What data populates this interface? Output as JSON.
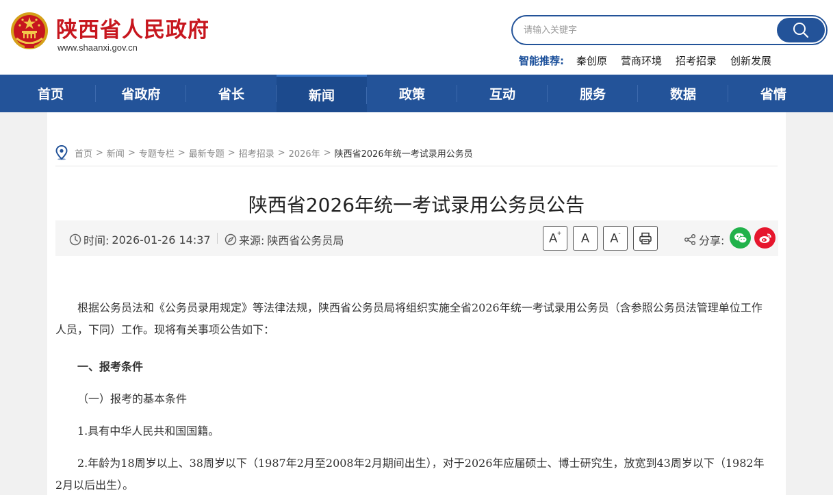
{
  "site": {
    "title": "陕西省人民政府",
    "domain": "www.shaanxi.gov.cn"
  },
  "search": {
    "placeholder": "请输入关键字",
    "icon": "search-icon"
  },
  "recommend": {
    "label": "智能推荐:",
    "items": [
      "秦创原",
      "营商环境",
      "招考招录",
      "创新发展"
    ]
  },
  "nav": {
    "items": [
      "首页",
      "省政府",
      "省长",
      "新闻",
      "政策",
      "互动",
      "服务",
      "数据",
      "省情"
    ],
    "active": "新闻"
  },
  "breadcrumb": {
    "items": [
      "首页",
      "新闻",
      "专题专栏",
      "最新专题",
      "招考招录",
      "2026年"
    ],
    "current": "陕西省2026年统一考试录用公务员",
    "separator": ">"
  },
  "article": {
    "title": "陕西省2026年统一考试录用公务员公告",
    "time_label": "时间:",
    "time": "2026-01-26 14:37",
    "source_label": "来源:",
    "source": "陕西省公务员局",
    "font_increase": "A",
    "font_reset": "A",
    "font_decrease": "A",
    "share_label": "分享:",
    "paragraphs": {
      "intro": "根据公务员法和《公务员录用规定》等法律法规，陕西省公务员局将组织实施全省2026年统一考试录用公务员（含参照公务员法管理单位工作人员，下同）工作。现将有关事项公告如下：",
      "section1": "一、报考条件",
      "subsection1": "（一）报考的基本条件",
      "item1": "1.具有中华人民共和国国籍。",
      "item2": "2.年龄为18周岁以上、38周岁以下（1987年2月至2008年2月期间出生），对于2026年应届硕士、博士研究生，放宽到43周岁以下（1982年2月以后出生）。"
    }
  },
  "colors": {
    "brand_blue": "#235399",
    "title_red": "#c7161e",
    "wechat_green": "#21b24b",
    "weibo_red": "#e6162d"
  }
}
